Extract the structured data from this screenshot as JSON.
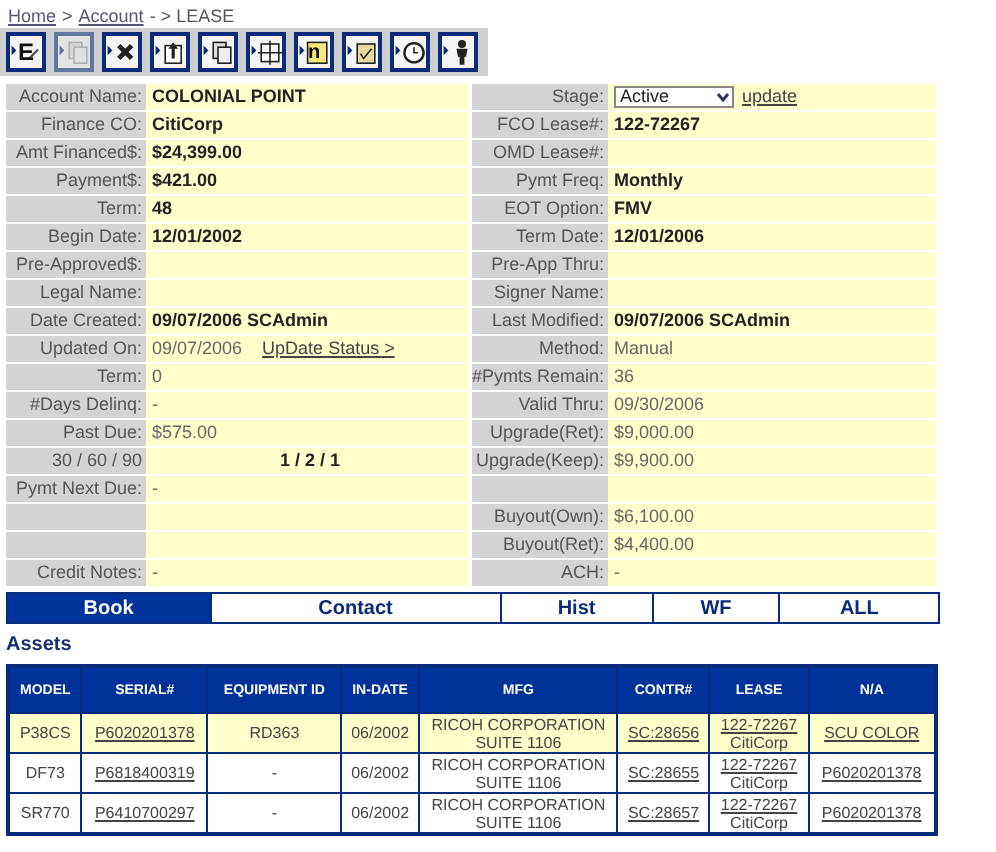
{
  "breadcrumb": [
    {
      "kind": "link",
      "text": "Home"
    },
    {
      "kind": "text",
      "text": ">"
    },
    {
      "kind": "link",
      "text": "Account"
    },
    {
      "kind": "text",
      "text": "- > LEASE"
    }
  ],
  "toolbar": [
    {
      "kind": "edit",
      "glyph": "E",
      "disabled": false
    },
    {
      "kind": "copy",
      "disabled": true
    },
    {
      "kind": "delete",
      "disabled": false
    },
    {
      "kind": "upload",
      "disabled": false
    },
    {
      "kind": "copy",
      "disabled": false
    },
    {
      "kind": "grid",
      "disabled": false
    },
    {
      "kind": "note",
      "glyph": "n",
      "disabled": false
    },
    {
      "kind": "clipboard",
      "disabled": false
    },
    {
      "kind": "clock",
      "disabled": false
    },
    {
      "kind": "person",
      "disabled": false
    }
  ],
  "form": [
    {
      "left": {
        "label": "Account Name:",
        "value": "COLONIAL POINT",
        "kind": "text",
        "bold": true
      },
      "right": {
        "label": "Stage:",
        "value": "Active",
        "link": "update",
        "kind": "select",
        "bold": false
      }
    },
    {
      "left": {
        "label": "Finance CO:",
        "value": "CitiCorp",
        "kind": "text",
        "bold": true
      },
      "right": {
        "label": "FCO Lease#:",
        "value": "122-72267",
        "kind": "text",
        "bold": true
      }
    },
    {
      "left": {
        "label": "Amt Financed$:",
        "value": "$24,399.00",
        "kind": "text",
        "bold": true
      },
      "right": {
        "label": "OMD Lease#:",
        "kind": "text"
      }
    },
    {
      "left": {
        "label": "Payment$:",
        "value": "$421.00",
        "kind": "text",
        "bold": true
      },
      "right": {
        "label": "Pymt Freq:",
        "value": "Monthly",
        "kind": "text",
        "bold": true
      }
    },
    {
      "left": {
        "label": "Term:",
        "value": "48",
        "kind": "text",
        "bold": true
      },
      "right": {
        "label": "EOT Option:",
        "value": "FMV",
        "kind": "text",
        "bold": true
      }
    },
    {
      "left": {
        "label": "Begin Date:",
        "value": "12/01/2002",
        "kind": "text",
        "bold": true
      },
      "right": {
        "label": "Term Date:",
        "value": "12/01/2006",
        "kind": "text",
        "bold": true
      }
    },
    {
      "left": {
        "label": "Pre-Approved$:",
        "kind": "text"
      },
      "right": {
        "label": "Pre-App Thru:",
        "kind": "text"
      }
    },
    {
      "left": {
        "label": "Legal Name:",
        "kind": "text"
      },
      "right": {
        "label": "Signer Name:",
        "kind": "text"
      }
    },
    {
      "left": {
        "label": "Date Created:",
        "value": "09/07/2006 SCAdmin",
        "kind": "text",
        "bold": true
      },
      "right": {
        "label": "Last Modified:",
        "value": "09/07/2006 SCAdmin",
        "kind": "text",
        "bold": true
      }
    },
    {
      "left": {
        "label": "Updated On:",
        "value": "09/07/2006",
        "link": "UpDate Status >",
        "kind": "text_link",
        "bold": false
      },
      "right": {
        "label": "Method:",
        "value": "Manual",
        "kind": "text",
        "bold": false
      }
    },
    {
      "left": {
        "label": "Term:",
        "value": "0",
        "kind": "text",
        "bold": false
      },
      "right": {
        "label": "#Pymts Remain:",
        "value": "36",
        "kind": "text",
        "bold": false
      }
    },
    {
      "left": {
        "label": "#Days Delinq:",
        "value": "-",
        "kind": "text",
        "bold": false
      },
      "right": {
        "label": "Valid Thru:",
        "value": "09/30/2006",
        "kind": "text",
        "bold": false
      }
    },
    {
      "left": {
        "label": "Past Due:",
        "value": "$575.00",
        "kind": "text",
        "bold": false
      },
      "right": {
        "label": "Upgrade(Ret):",
        "value": "$9,000.00",
        "kind": "text",
        "bold": false
      }
    },
    {
      "left": {
        "label": "30 / 60 / 90",
        "value": "1 / 2 / 1",
        "kind": "centered",
        "bold": true
      },
      "right": {
        "label": "Upgrade(Keep):",
        "value": "$9,900.00",
        "kind": "text",
        "bold": false
      }
    },
    {
      "left": {
        "label": "Pymt Next Due:",
        "value": "-",
        "kind": "text",
        "bold": false
      },
      "right": {
        "kind": "text"
      }
    },
    {
      "left": {
        "kind": "text"
      },
      "right": {
        "label": "Buyout(Own):",
        "value": "$6,100.00",
        "kind": "text",
        "bold": false
      }
    },
    {
      "left": {
        "kind": "text"
      },
      "right": {
        "label": "Buyout(Ret):",
        "value": "$4,400.00",
        "kind": "text",
        "bold": false
      }
    },
    {
      "left": {
        "label": "Credit Notes:",
        "value": "-",
        "kind": "text",
        "bold": false
      },
      "right": {
        "label": "ACH:",
        "value": "-",
        "kind": "text",
        "bold": false
      }
    }
  ],
  "tabs": [
    {
      "label": "Book",
      "selected": true
    },
    {
      "label": "Contact",
      "selected": false
    },
    {
      "label": "Hist",
      "selected": false
    },
    {
      "label": "WF",
      "selected": false
    },
    {
      "label": "ALL",
      "selected": false
    }
  ],
  "assets": {
    "title": "Assets",
    "columns": [
      "MODEL",
      "SERIAL#",
      "EQUIPMENT ID",
      "IN-DATE",
      "MFG",
      "CONTR#",
      "LEASE",
      "N/A"
    ],
    "rows": [
      {
        "model": "P38CS",
        "serial": "P6020201378",
        "equipment_id": "RD363",
        "in_date": "06/2002",
        "mfg": "RICOH CORPORATION SUITE 1106",
        "contract": "SC:28656",
        "lease": "122-72267",
        "lease_company": "CitiCorp",
        "na": "SCU COLOR",
        "selected": true
      },
      {
        "model": "DF73",
        "serial": "P6818400319",
        "equipment_id": "-",
        "in_date": "06/2002",
        "mfg": "RICOH CORPORATION SUITE 1106",
        "contract": "SC:28655",
        "lease": "122-72267",
        "lease_company": "CitiCorp",
        "na": "P6020201378",
        "selected": false
      },
      {
        "model": "SR770",
        "serial": "P6410700297",
        "equipment_id": "-",
        "in_date": "06/2002",
        "mfg": "RICOH CORPORATION SUITE 1106",
        "contract": "SC:28657",
        "lease": "122-72267",
        "lease_company": "CitiCorp",
        "na": "P6020201378",
        "selected": false
      }
    ]
  }
}
